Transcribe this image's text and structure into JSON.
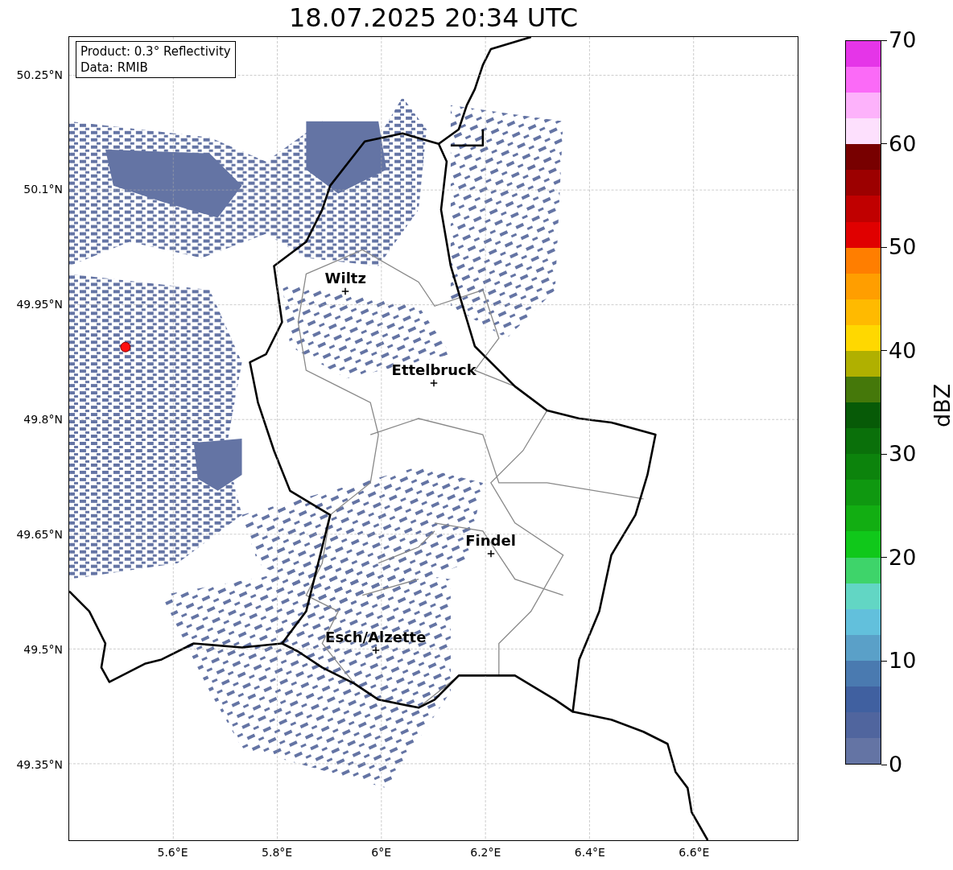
{
  "title": "18.07.2025 20:34 UTC",
  "info_box": [
    "Product: 0.3° Reflectivity",
    "Data: RMIB"
  ],
  "map": {
    "y_tick_labels": [
      "50.25°N",
      "50.1°N",
      "49.95°N",
      "49.8°N",
      "49.65°N",
      "49.5°N",
      "49.35°N"
    ],
    "x_tick_labels": [
      "5.6°E",
      "5.8°E",
      "6°E",
      "6.2°E",
      "6.4°E",
      "6.6°E"
    ],
    "places": [
      {
        "name": "Wiltz"
      },
      {
        "name": "Ettelbruck"
      },
      {
        "name": "Findel"
      },
      {
        "name": "Esch/Alzette"
      }
    ]
  },
  "colorbar": {
    "label": "dBZ",
    "ticks": [
      "70",
      "60",
      "50",
      "40",
      "30",
      "20",
      "10",
      "0"
    ],
    "segments": [
      {
        "color": "#e535e8"
      },
      {
        "color": "#fb6af7"
      },
      {
        "color": "#fdb2fb"
      },
      {
        "color": "#fde0fd"
      },
      {
        "color": "#780000"
      },
      {
        "color": "#9c0000"
      },
      {
        "color": "#c00000"
      },
      {
        "color": "#e00000"
      },
      {
        "color": "#ff7e00"
      },
      {
        "color": "#ff9e00"
      },
      {
        "color": "#ffba00"
      },
      {
        "color": "#ffd800"
      },
      {
        "color": "#b0b000"
      },
      {
        "color": "#45780a"
      },
      {
        "color": "#075a07"
      },
      {
        "color": "#0a700a"
      },
      {
        "color": "#0c830c"
      },
      {
        "color": "#0f9810"
      },
      {
        "color": "#12ae12"
      },
      {
        "color": "#10c81a"
      },
      {
        "color": "#3ed46a"
      },
      {
        "color": "#62d6c4"
      },
      {
        "color": "#62c0dc"
      },
      {
        "color": "#5aa0c8"
      },
      {
        "color": "#4a7ab0"
      },
      {
        "color": "#4060a0"
      },
      {
        "color": "#50659e"
      },
      {
        "color": "#6474a4"
      }
    ]
  }
}
